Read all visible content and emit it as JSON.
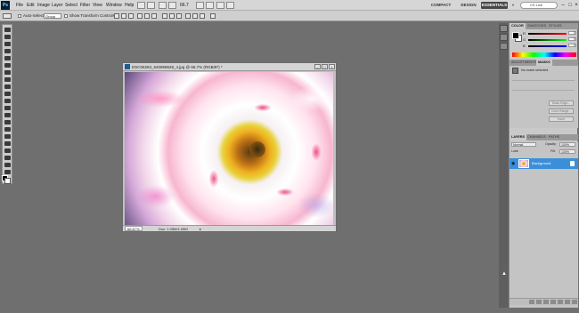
{
  "app": {
    "logo": "Ps"
  },
  "menu": [
    "File",
    "Edit",
    "Image",
    "Layer",
    "Select",
    "Filter",
    "View",
    "Window",
    "Help"
  ],
  "zoom_menu": "66.7",
  "workspaces": {
    "compact": "COMPACT",
    "design": "DESIGN",
    "essentials": "ESSENTIALS",
    "more": "»"
  },
  "live_search_label": "CS Live",
  "options_bar": {
    "auto_select": "Auto-Select:",
    "group": "Group",
    "show_transform": "Show Transform Controls"
  },
  "document": {
    "title": "DSC06263_640959628_4.jpg @ 66.7% (RGB/8*) *",
    "zoom": "66.67%",
    "doc_size": "Doc: 1.05M/1.05M"
  },
  "color_panel": {
    "tabs": [
      "COLOR",
      "SWATCHES",
      "STYLES"
    ],
    "r": "R",
    "g": "G",
    "b": "B",
    "r_val": "0",
    "g_val": "0",
    "b_val": "0"
  },
  "adjustments_panel": {
    "tabs": [
      "ADJUSTMENTS",
      "MASKS"
    ],
    "title": "No mask selected",
    "btn1": "Mask Edge...",
    "btn2": "Color Range...",
    "btn3": "Invert"
  },
  "layers_panel": {
    "tabs": [
      "LAYERS",
      "CHANNELS",
      "PATHS"
    ],
    "blend": "Normal",
    "opacity_label": "Opacity:",
    "opacity": "100%",
    "lock_label": "Lock:",
    "fill_label": "Fill:",
    "fill": "100%",
    "layer_name": "Background"
  },
  "colors": {
    "selection": "#3b8fd9",
    "workspace": "#6f6f6f"
  }
}
